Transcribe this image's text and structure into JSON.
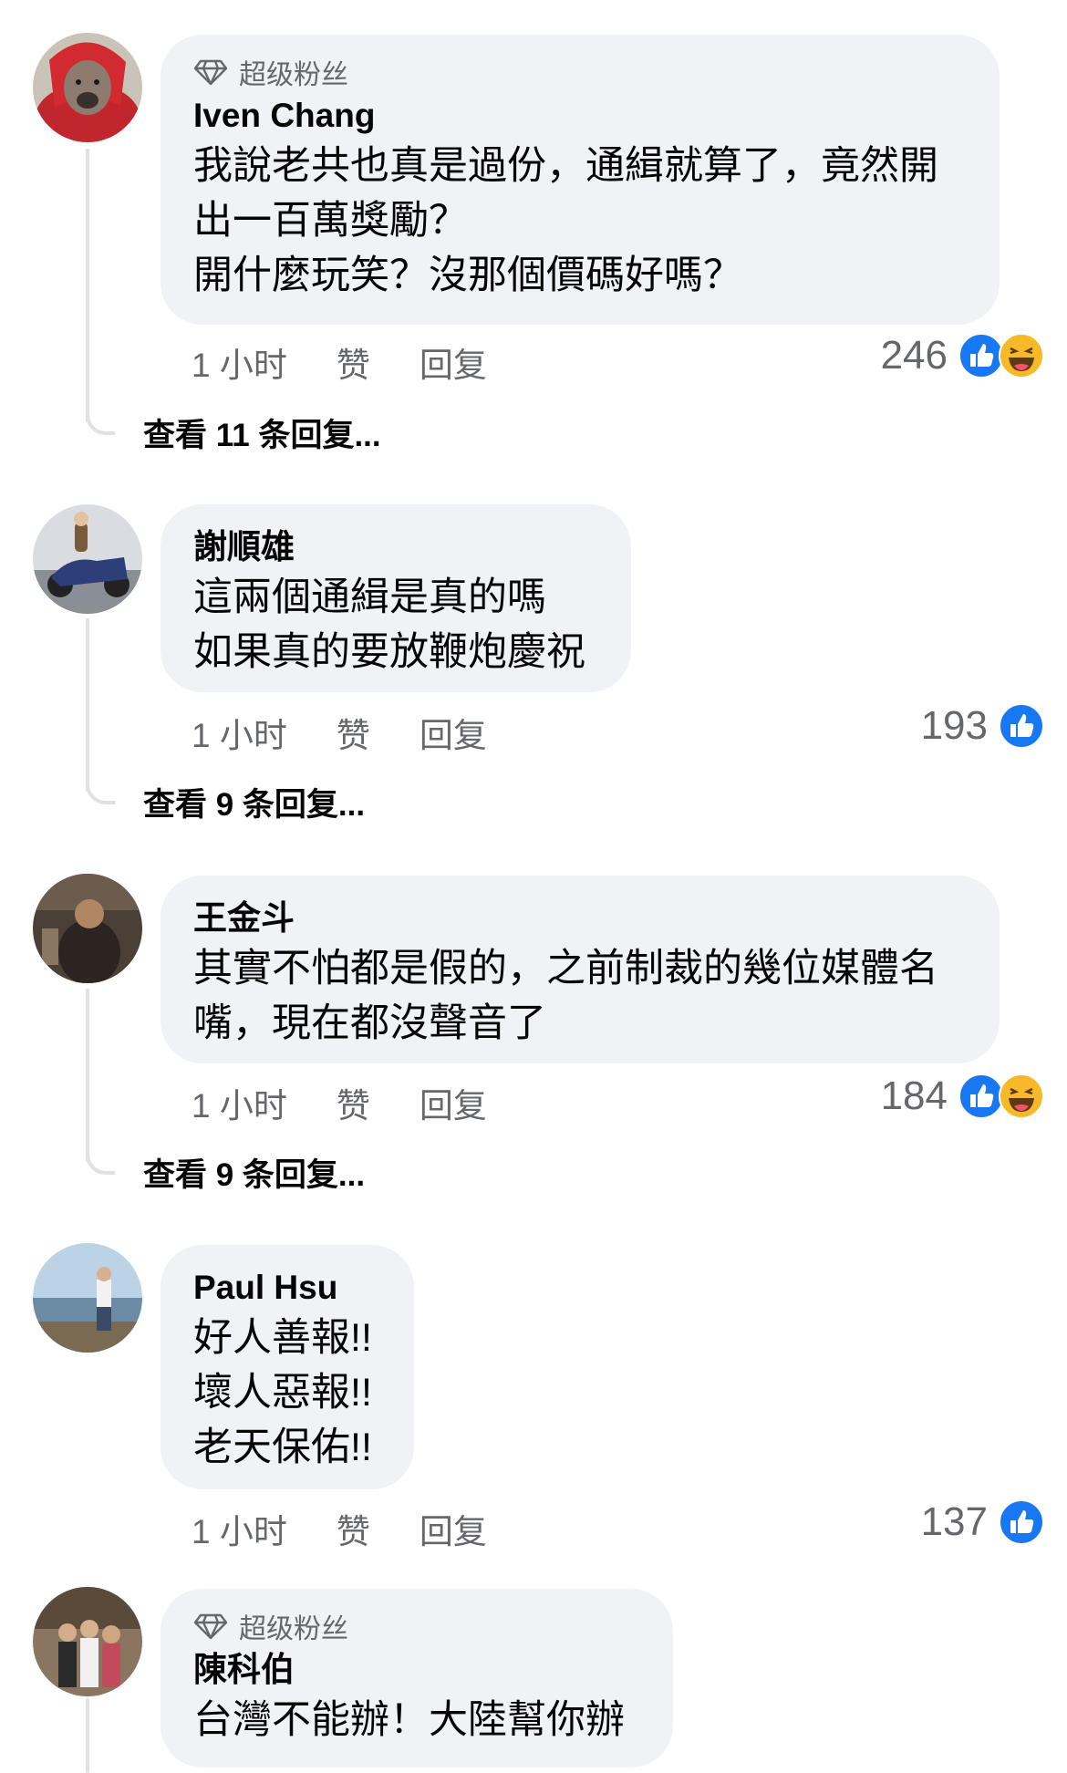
{
  "comments": [
    {
      "badge": "超级粉丝",
      "author": "Iven Chang",
      "lines": [
        "我說老共也真是過份，通緝就算了，竟然開",
        "出一百萬獎勵？",
        "開什麼玩笑？沒那個價碼好嗎？"
      ],
      "time": "1 小时",
      "like": "赞",
      "reply": "回复",
      "count": "246",
      "reactions": [
        "like-icon",
        "haha-icon"
      ],
      "view_replies": "查看 11 条回复..."
    },
    {
      "author": "謝順雄",
      "lines": [
        "這兩個通緝是真的嗎",
        "如果真的要放鞭炮慶祝"
      ],
      "time": "1 小时",
      "like": "赞",
      "reply": "回复",
      "count": "193",
      "reactions": [
        "like-icon"
      ],
      "view_replies": "查看 9 条回复..."
    },
    {
      "author": "王金斗",
      "lines": [
        "其實不怕都是假的，之前制裁的幾位媒體名",
        "嘴，現在都沒聲音了"
      ],
      "time": "1 小时",
      "like": "赞",
      "reply": "回复",
      "count": "184",
      "reactions": [
        "like-icon",
        "haha-icon"
      ],
      "view_replies": "查看 9 条回复..."
    },
    {
      "author": "Paul Hsu",
      "lines": [
        "好人善報!!",
        "壞人惡報!!",
        "老天保佑!!"
      ],
      "time": "1 小时",
      "like": "赞",
      "reply": "回复",
      "count": "137",
      "reactions": [
        "like-icon"
      ]
    },
    {
      "badge": "超级粉丝",
      "author": "陳科伯",
      "lines": [
        "台灣不能辦！大陸幫你辦"
      ]
    }
  ],
  "colors": {
    "bubble": "#f0f2f5",
    "meta": "#65676b",
    "like_blue": "#1877f2",
    "haha_yellow": "#f7b928"
  }
}
